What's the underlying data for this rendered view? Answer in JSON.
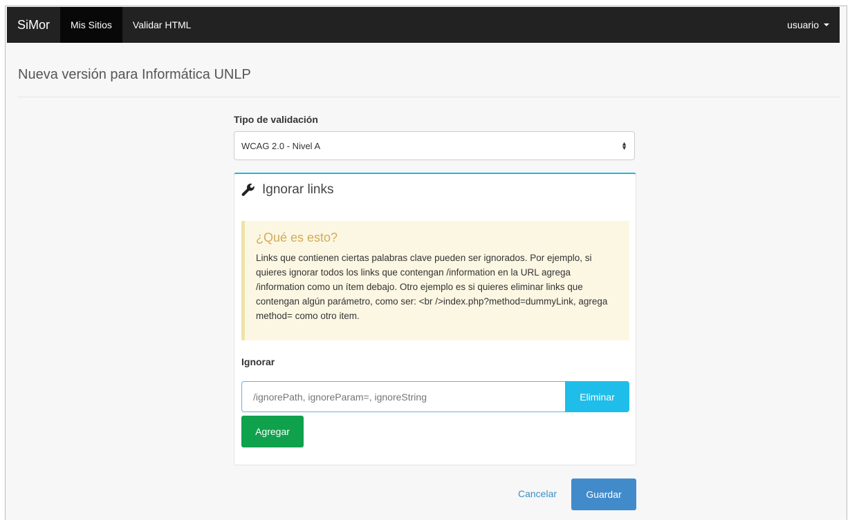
{
  "navbar": {
    "brand": "SiMor",
    "items": [
      {
        "label": "Mis Sitios",
        "active": true
      },
      {
        "label": "Validar HTML",
        "active": false
      }
    ],
    "user_menu": "usuario"
  },
  "page": {
    "title": "Nueva versión para Informática UNLP"
  },
  "form": {
    "validation_type_label": "Tipo de validación",
    "validation_type_selected": "WCAG 2.0 - Nivel A",
    "panel": {
      "title": "Ignorar links",
      "icon": "wrench-icon",
      "callout_title": "¿Qué es esto?",
      "callout_text": "Links que contienen ciertas palabras clave pueden ser ignorados. Por ejemplo, si quieres ignorar todos los links que contengan /information en la URL agrega /information como un ítem debajo. Otro ejemplo es si quieres eliminar links que contengan algún parámetro, como ser: <br />index.php?method=dummyLink, agrega method= como otro item.",
      "ignore_label": "Ignorar",
      "ignore_placeholder": "/ignorePath, ignoreParam=, ignoreString",
      "ignore_value": "",
      "remove_label": "Eliminar",
      "add_label": "Agregar"
    },
    "cancel_label": "Cancelar",
    "save_label": "Guardar"
  },
  "colors": {
    "navbar_bg": "#222222",
    "panel_accent": "#1fb5e6",
    "success": "#0fa14b",
    "primary": "#428bca",
    "callout_bg": "#fcf7e3"
  }
}
